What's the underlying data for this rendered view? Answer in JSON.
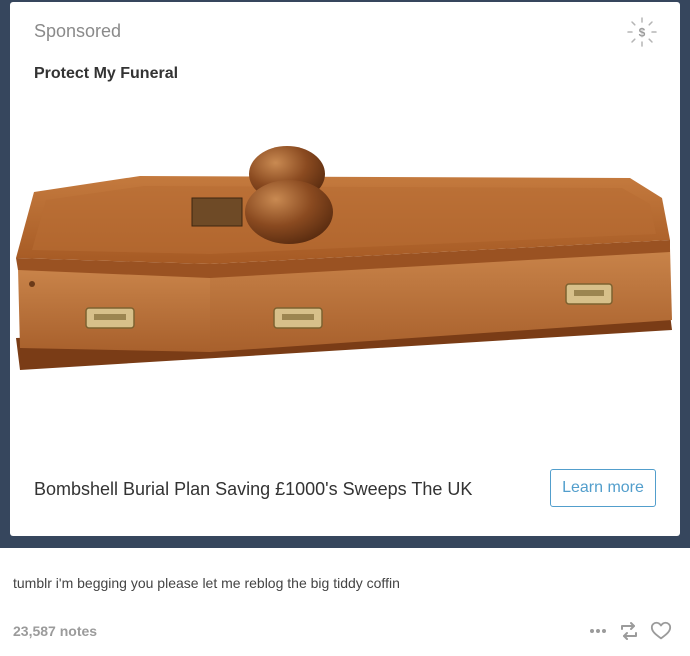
{
  "ad": {
    "sponsored_label": "Sponsored",
    "advertiser": "Protect My Funeral",
    "headline": "Bombshell Burial Plan Saving £1000's Sweeps The UK",
    "cta_label": "Learn more",
    "sponsor_icon": "dollar-badge-icon",
    "image_subject": "wooden coffin with two round wooden knobs"
  },
  "post": {
    "caption": "tumblr i'm begging you please let me reblog the big tiddy coffin",
    "notes": "23,587 notes",
    "actions": [
      "more-options-icon",
      "reblog-icon",
      "like-heart-icon"
    ]
  },
  "colors": {
    "frame": "#36465d",
    "accent": "#529ecc",
    "wood": "#b8692f"
  }
}
